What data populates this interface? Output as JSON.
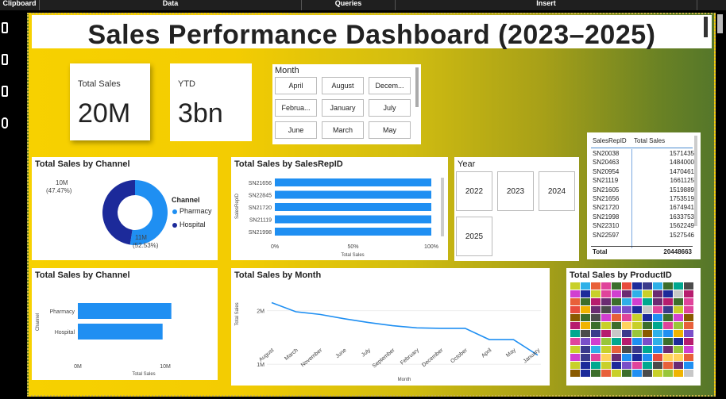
{
  "ribbon": {
    "groups": [
      "Clipboard",
      "Data",
      "Queries",
      "Insert"
    ]
  },
  "dashboard": {
    "title": "Sales Performance Dashboard (2023–2025)"
  },
  "kpis": [
    {
      "label": "Total Sales",
      "value": "20M"
    },
    {
      "label": "YTD",
      "value": "3bn"
    }
  ],
  "month_slicer": {
    "title": "Month",
    "options": [
      "April",
      "August",
      "Decem...",
      "Februa...",
      "January",
      "July",
      "June",
      "March",
      "May"
    ]
  },
  "year_slicer": {
    "title": "Year",
    "options": [
      "2022",
      "2023",
      "2024",
      "2025"
    ]
  },
  "channel_donut": {
    "title": "Total Sales by Channel",
    "legend_title": "Channel",
    "labels": [
      {
        "value": "10M",
        "pct": "(47.47%)"
      },
      {
        "value": "11M",
        "pct": "(52.53%)"
      }
    ]
  },
  "salesrep_bar": {
    "title": "Total Sales by SalesRepID"
  },
  "channel_bar": {
    "title": "Total Sales by Channel"
  },
  "month_line": {
    "title": "Total Sales by Month"
  },
  "product_heat": {
    "title": "Total Sales by ProductID"
  },
  "rep_table": {
    "headers": [
      "SalesRepID",
      "Total Sales"
    ],
    "rows": [
      [
        "SN20038",
        "1571435"
      ],
      [
        "SN20463",
        "1484000"
      ],
      [
        "SN20954",
        "1470461"
      ],
      [
        "SN21119",
        "1661125"
      ],
      [
        "SN21605",
        "1519889"
      ],
      [
        "SN21656",
        "1753519"
      ],
      [
        "SN21720",
        "1674941"
      ],
      [
        "SN21998",
        "1633753"
      ],
      [
        "SN22310",
        "1562249"
      ],
      [
        "SN22597",
        "1527546"
      ]
    ],
    "total_label": "Total",
    "total_value": "20448663"
  },
  "colors": {
    "accent": "#1f8ff2",
    "dark_blue": "#1c2a9a",
    "light_blue": "#1f8ff2"
  },
  "chart_data": [
    {
      "type": "pie",
      "title": "Total Sales by Channel",
      "categories": [
        "Pharmacy",
        "Hospital"
      ],
      "values": [
        10.7,
        9.7
      ],
      "legend": "right"
    },
    {
      "type": "bar",
      "title": "Total Sales by SalesRepID",
      "categories": [
        "SN21656",
        "SN22845",
        "SN21720",
        "SN21119",
        "SN21998"
      ],
      "values": [
        100,
        100,
        100,
        100,
        100
      ],
      "ylabel": "SalesRepID",
      "xlabel": "Total Sales",
      "xticks": [
        "0%",
        "50%",
        "100%"
      ],
      "xlim": [
        0,
        100
      ]
    },
    {
      "type": "bar",
      "title": "Total Sales by Channel",
      "categories": [
        "Pharmacy",
        "Hospital"
      ],
      "values": [
        10.7,
        9.7
      ],
      "ylabel": "Channel",
      "xlabel": "Total Sales",
      "xticks": [
        "0M",
        "10M"
      ],
      "xlim": [
        0,
        10
      ]
    },
    {
      "type": "line",
      "title": "Total Sales by Month",
      "x": [
        "August",
        "March",
        "November",
        "June",
        "July",
        "September",
        "February",
        "December",
        "October",
        "April",
        "May",
        "January"
      ],
      "values": [
        2.15,
        1.98,
        1.93,
        1.85,
        1.78,
        1.72,
        1.68,
        1.67,
        1.67,
        1.46,
        1.46,
        1.17
      ],
      "ylabel": "Total Sales",
      "xlabel": "Month",
      "yticks": [
        "1M",
        "2M"
      ],
      "ylim": [
        0.9,
        2.35
      ]
    }
  ]
}
